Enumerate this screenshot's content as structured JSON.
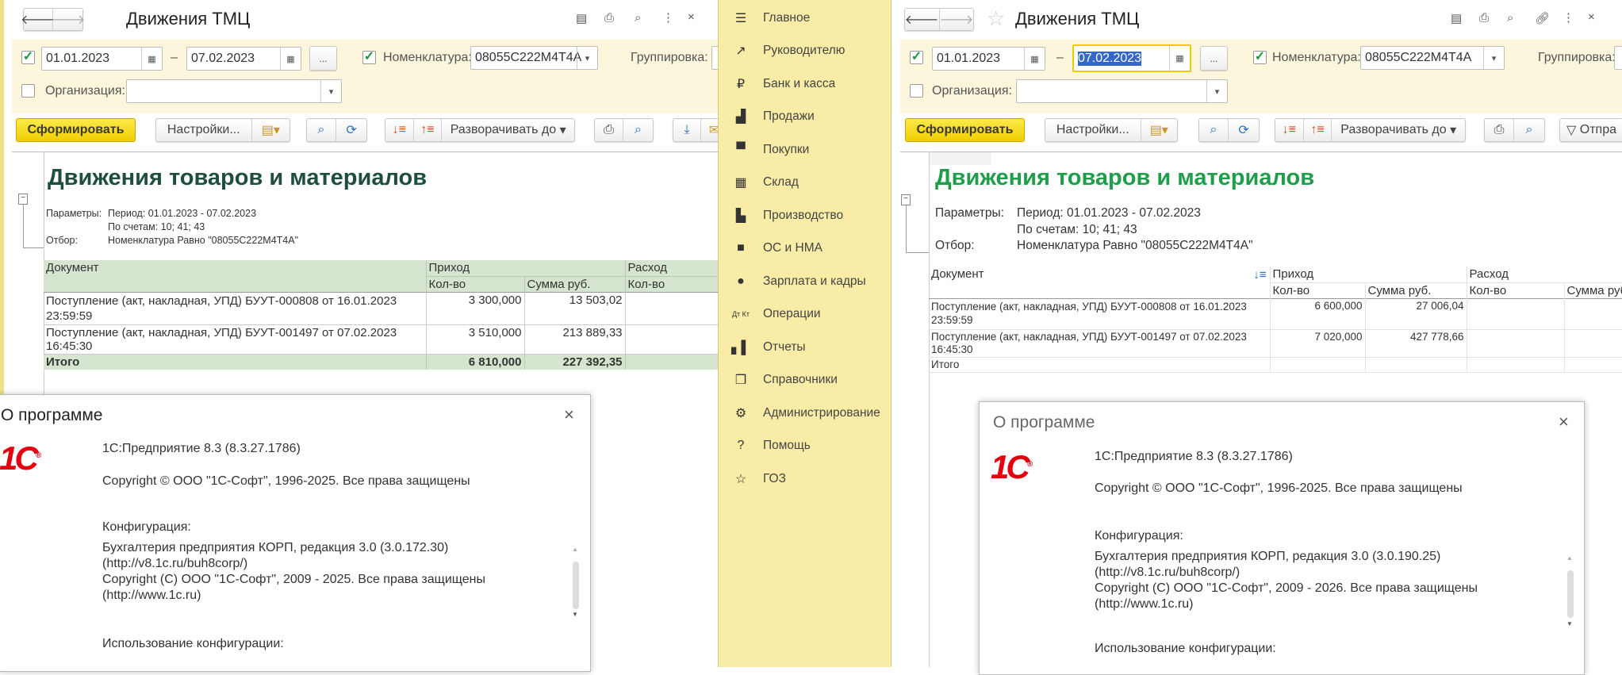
{
  "left": {
    "title": "Движения ТМЦ",
    "date_from": "01.01.2023",
    "date_to": "07.02.2023",
    "dash": "–",
    "more": "...",
    "nomenclature_label": "Номенклатура:",
    "nomenclature_value": "08055C222M4T4A",
    "grouping_label": "Группировка:",
    "organization_label": "Организация:",
    "generate": "Сформировать",
    "settings": "Настройки...",
    "expand": "Разворачивать до",
    "report": {
      "title": "Движения товаров и материалов",
      "params_label": "Параметры:",
      "period": "Период: 01.01.2023 - 07.02.2023",
      "accounts": "По счетам: 10; 41; 43",
      "filter_label": "Отбор:",
      "filter": "Номенклатура Равно \"08055C222M4T4A\"",
      "headers": {
        "doc": "Документ",
        "income": "Приход",
        "expense": "Расход",
        "qty": "Кол-во",
        "sum": "Сумма руб."
      },
      "rows": [
        {
          "doc": "Поступление (акт, накладная, УПД) БУУТ-000808 от 16.01.2023",
          "time": "23:59:59",
          "qty": "3 300,000",
          "sum": "13 503,02"
        },
        {
          "doc": "Поступление (акт, накладная, УПД) БУУТ-001497 от 07.02.2023",
          "time": "16:45:30",
          "qty": "3 510,000",
          "sum": "213 889,33"
        }
      ],
      "total": {
        "label": "Итого",
        "qty": "6 810,000",
        "sum": "227 392,35"
      }
    },
    "about": {
      "title": "О программе",
      "platform": "1С:Предприятие 8.3 (8.3.27.1786)",
      "copyright": "Copyright © ООО \"1С-Софт\", 1996-2025. Все права защищены",
      "config_label": "Конфигурация:",
      "config": "Бухгалтерия предприятия КОРП, редакция 3.0 (3.0.172.30)",
      "config_url": "(http://v8.1c.ru/buh8corp/)",
      "config_copyright": "Copyright (C) ООО \"1С-Софт\", 2009 - 2025. Все права защищены",
      "site": "(http://www.1c.ru)",
      "usage_label": "Использование конфигурации:",
      "logo_text": "1С"
    }
  },
  "sidebar": {
    "items": [
      "Главное",
      "Руководителю",
      "Банк и касса",
      "Продажи",
      "Покупки",
      "Склад",
      "Производство",
      "ОС и НМА",
      "Зарплата и кадры",
      "Операции",
      "Отчеты",
      "Справочники",
      "Администрирование",
      "Помощь",
      "ГОЗ"
    ]
  },
  "right": {
    "title": "Движения ТМЦ",
    "date_from": "01.01.2023",
    "date_to": "07.02.2023",
    "dash": "–",
    "more": "...",
    "nomenclature_label": "Номенклатура:",
    "nomenclature_value": "08055C222M4T4A",
    "grouping_label": "Группировка:",
    "organization_label": "Организация:",
    "generate": "Сформировать",
    "settings": "Настройки...",
    "expand": "Разворачивать до",
    "send": "Отпра",
    "report": {
      "title": "Движения товаров и материалов",
      "params_label": "Параметры:",
      "period": "Период: 01.01.2023 - 07.02.2023",
      "accounts": "По счетам: 10; 41; 43",
      "filter_label": "Отбор:",
      "filter": "Номенклатура Равно \"08055C222M4T4A\"",
      "headers": {
        "doc": "Документ",
        "income": "Приход",
        "expense": "Расход",
        "qty": "Кол-во",
        "sum": "Сумма руб."
      },
      "rows": [
        {
          "doc": "Поступление (акт, накладная, УПД) БУУТ-000808 от 16.01.2023",
          "time": "23:59:59",
          "qty": "6 600,000",
          "sum": "27 006,04"
        },
        {
          "doc": "Поступление (акт, накладная, УПД) БУУТ-001497 от 07.02.2023",
          "time": "16:45:30",
          "qty": "7 020,000",
          "sum": "427 778,66"
        }
      ],
      "total": {
        "label": "Итого"
      }
    },
    "about": {
      "title": "О программе",
      "platform": "1С:Предприятие 8.3 (8.3.27.1786)",
      "copyright": "Copyright © ООО \"1С-Софт\", 1996-2025. Все права защищены",
      "config_label": "Конфигурация:",
      "config": "Бухгалтерия предприятия КОРП, редакция 3.0 (3.0.190.25)",
      "config_url": "(http://v8.1c.ru/buh8corp/)",
      "config_copyright": "Copyright (C) ООО \"1С-Софт\", 2009 - 2026. Все права защищены",
      "site": "(http://www.1c.ru)",
      "usage_label": "Использование конфигурации:",
      "logo_text": "1С"
    }
  },
  "colors": {
    "generate": "#f5d800",
    "band": "#fbf6dc",
    "sidebar": "#f9eca6",
    "left_title": "#1f4e3d",
    "right_title": "#1f9d4a",
    "table_header": "#d6e5cf",
    "logo": "#e4000f"
  }
}
